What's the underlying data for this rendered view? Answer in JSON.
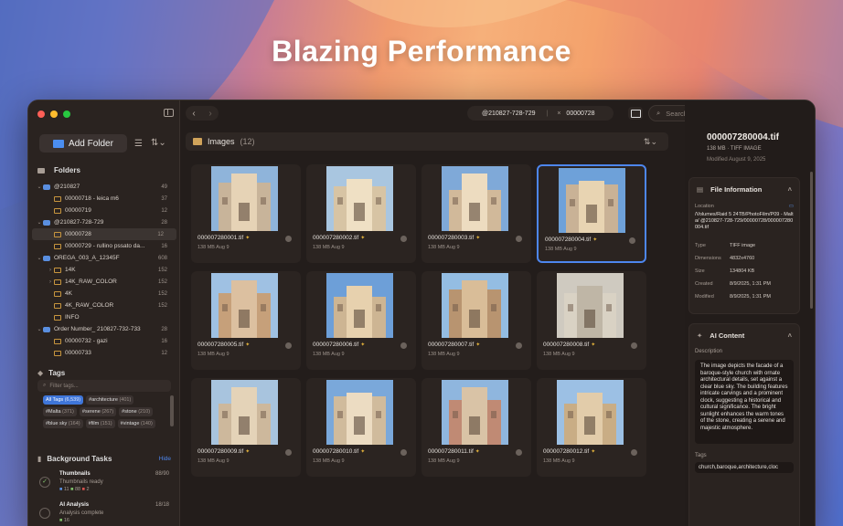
{
  "hero_title": "Blazing Performance",
  "sidebar": {
    "add_folder_label": "Add Folder",
    "folders_heading": "Folders",
    "tree": [
      {
        "label": "@210827",
        "count": "49",
        "level": 0,
        "kind": "drive",
        "chev": "⌄"
      },
      {
        "label": "00000718 - leica m6",
        "count": "37",
        "level": 1,
        "kind": "folder",
        "chev": ""
      },
      {
        "label": "00000719",
        "count": "12",
        "level": 1,
        "kind": "folder",
        "chev": ""
      },
      {
        "label": "@210827-728-729",
        "count": "28",
        "level": 0,
        "kind": "drive",
        "chev": "⌄"
      },
      {
        "label": "00000728",
        "count": "12",
        "level": 1,
        "kind": "folder",
        "chev": "",
        "selected": true
      },
      {
        "label": "00000729 - rullino pssato da...",
        "count": "16",
        "level": 1,
        "kind": "folder",
        "chev": ""
      },
      {
        "label": "OREGA_003_A_12345F",
        "count": "608",
        "level": 0,
        "kind": "drive",
        "chev": "⌄"
      },
      {
        "label": "14K",
        "count": "152",
        "level": 1,
        "kind": "folder",
        "chev": "›"
      },
      {
        "label": "14K_RAW_COLOR",
        "count": "152",
        "level": 1,
        "kind": "folder",
        "chev": "›"
      },
      {
        "label": "4K",
        "count": "152",
        "level": 1,
        "kind": "folder",
        "chev": ""
      },
      {
        "label": "4K_RAW_COLOR",
        "count": "152",
        "level": 1,
        "kind": "folder",
        "chev": ""
      },
      {
        "label": "INFO",
        "count": "",
        "level": 1,
        "kind": "folder",
        "chev": ""
      },
      {
        "label": "Order Number_ 210827-732-733",
        "count": "28",
        "level": 0,
        "kind": "drive",
        "chev": "⌄"
      },
      {
        "label": "00000732 - gazi",
        "count": "16",
        "level": 1,
        "kind": "folder",
        "chev": ""
      },
      {
        "label": "00000733",
        "count": "12",
        "level": 1,
        "kind": "folder",
        "chev": ""
      }
    ],
    "tags_heading": "Tags",
    "tags_placeholder": "Filter tags...",
    "tags": [
      {
        "name": "All Tags",
        "count": "(6,539)",
        "selected": true
      },
      {
        "name": "#architecture",
        "count": "(401)"
      },
      {
        "name": "#Malta",
        "count": "(371)"
      },
      {
        "name": "#serene",
        "count": "(267)"
      },
      {
        "name": "#stone",
        "count": "(210)"
      },
      {
        "name": "#blue sky",
        "count": "(164)"
      },
      {
        "name": "#film",
        "count": "(151)"
      },
      {
        "name": "#vintage",
        "count": "(140)"
      }
    ],
    "tasks_heading": "Background Tasks",
    "tasks_hide": "Hide",
    "tasks": [
      {
        "name": "Thumbnails",
        "progress": "88/90",
        "status": "Thumbnails ready",
        "s1": "11",
        "s2": "88",
        "s3": "2"
      },
      {
        "name": "AI Analysis",
        "progress": "18/18",
        "status": "Analysis complete",
        "s1": "16"
      }
    ]
  },
  "toolbar": {
    "tab1": "@210827-728-729",
    "tab_sep": "|",
    "tab2": "00000728",
    "search_placeholder": "Search"
  },
  "images": {
    "heading": "Images",
    "count": "(12)",
    "items": [
      {
        "name": "000007280001.tif",
        "meta": "138 MB   Aug 9"
      },
      {
        "name": "000007280002.tif",
        "meta": "138 MB   Aug 9"
      },
      {
        "name": "000007280003.tif",
        "meta": "138 MB   Aug 9"
      },
      {
        "name": "000007280004.tif",
        "meta": "138 MB   Aug 9",
        "selected": true
      },
      {
        "name": "000007280005.tif",
        "meta": "138 MB   Aug 9"
      },
      {
        "name": "000007280006.tif",
        "meta": "138 MB   Aug 9"
      },
      {
        "name": "000007280007.tif",
        "meta": "138 MB   Aug 9"
      },
      {
        "name": "000007280008.tif",
        "meta": "138 MB   Aug 9"
      },
      {
        "name": "000007280009.tif",
        "meta": "138 MB   Aug 9"
      },
      {
        "name": "000007280010.tif",
        "meta": "138 MB   Aug 9"
      },
      {
        "name": "000007280011.tif",
        "meta": "138 MB   Aug 9"
      },
      {
        "name": "000007280012.tif",
        "meta": "138 MB   Aug 9"
      }
    ]
  },
  "inspector": {
    "title": "000007280004.tif",
    "size_type": "138 MB  ·  TIFF IMAGE",
    "modified": "Modified August 9, 2025",
    "file_info_heading": "File Information",
    "location_label": "Location",
    "location_value": "/Volumes/Raid 5  24TB/PhotoFilm/P09 - Malta/ @210827-728-729/00000728/000007280004.tif",
    "rows": [
      {
        "k": "Type",
        "v": "TIFF image"
      },
      {
        "k": "Dimensions",
        "v": "4832x4760"
      },
      {
        "k": "Size",
        "v": "134804 KB"
      },
      {
        "k": "Created",
        "v": "8/9/2025, 1:31 PM"
      },
      {
        "k": "Modified",
        "v": "8/9/2025, 1:31 PM"
      }
    ],
    "ai_heading": "AI Content",
    "description_label": "Description",
    "description": "The image depicts the facade of a baroque-style church with ornate architectural details, set against a clear blue sky. The building features intricate carvings and a prominent clock, suggesting a historical and cultural significance. The bright sunlight enhances the warm tones of the stone, creating a serene and majestic atmosphere.",
    "tags_label": "Tags",
    "tags_value": "church,baroque,architecture,cloc"
  }
}
